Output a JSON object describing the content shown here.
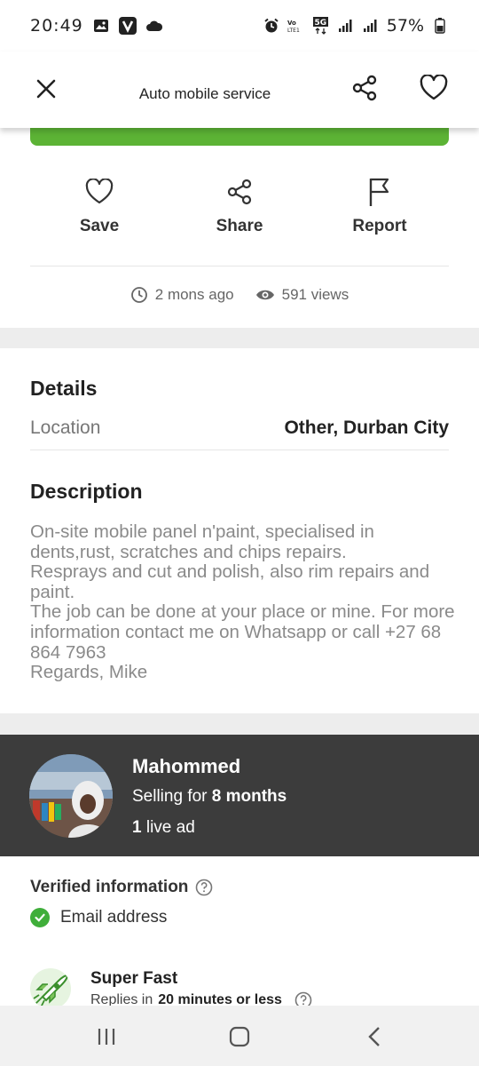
{
  "status_bar": {
    "time": "20:49",
    "battery": "57%",
    "icons": [
      "gallery-icon",
      "v-app-icon",
      "cloud-icon",
      "alarm-icon",
      "volte-icon",
      "5g-icon",
      "signal-icon",
      "signal-icon",
      "battery-icon"
    ]
  },
  "header": {
    "title": "Auto mobile service"
  },
  "colors": {
    "accent_green": "#5cb335",
    "seller_bg": "#3c3c3c",
    "check_green": "#3fae3a"
  },
  "actions": {
    "save": "Save",
    "share": "Share",
    "report": "Report"
  },
  "meta": {
    "posted": "2 mons ago",
    "views": "591 views"
  },
  "details": {
    "title": "Details",
    "location_label": "Location",
    "location_value": "Other, Durban City"
  },
  "description": {
    "title": "Description",
    "lines": [
      "On-site mobile panel n'paint, specialised in dents,rust, scratches and chips repairs.",
      "Resprays and cut and polish, also rim repairs and paint.",
      "The job can be done at your place or mine. For more information contact me on Whatsapp or call +27 68 864 7963",
      "Regards, Mike"
    ]
  },
  "seller": {
    "name": "Mahommed",
    "selling_prefix": "Selling for ",
    "selling_duration": "8 months",
    "live_count": "1",
    "live_suffix": " live ad"
  },
  "verified": {
    "title": "Verified information",
    "email": "Email address"
  },
  "badge": {
    "title": "Super Fast",
    "sub_prefix": "Replies in ",
    "sub_value": "20 minutes or less"
  }
}
